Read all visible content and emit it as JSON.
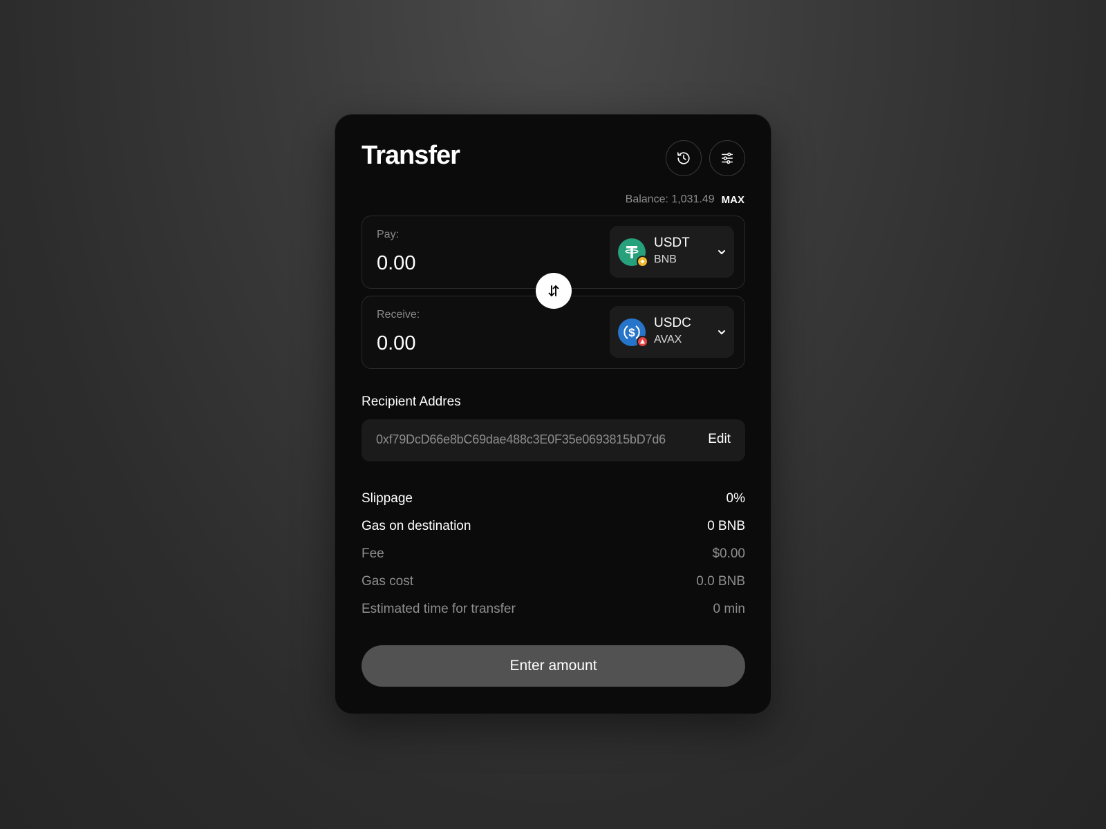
{
  "header": {
    "title": "Transfer",
    "history_icon": "history-clock-icon",
    "settings_icon": "sliders-settings-icon"
  },
  "balance": {
    "text": "Balance: 1,031.49",
    "max_label": "MAX"
  },
  "pay": {
    "label": "Pay:",
    "amount": "0.00",
    "token": {
      "symbol": "USDT",
      "chain": "BNB",
      "logo_color": "#26a17b",
      "badge_color": "#f3ba2f"
    }
  },
  "receive": {
    "label": "Receive:",
    "amount": "0.00",
    "token": {
      "symbol": "USDC",
      "chain": "AVAX",
      "logo_color": "#2775ca",
      "badge_color": "#e84142"
    }
  },
  "swap_icon": "swap-arrows-icon",
  "recipient": {
    "label": "Recipient Addres",
    "address": "0xf79DcD66e8bC69dae488c3E0F35e0693815bD7d6",
    "edit_label": "Edit"
  },
  "details": [
    {
      "label": "Slippage",
      "value": "0%",
      "style": "primary"
    },
    {
      "label": "Gas on destination",
      "value": "0 BNB",
      "style": "primary"
    },
    {
      "label": "Fee",
      "value": "$0.00",
      "style": "secondary"
    },
    {
      "label": "Gas cost",
      "value": "0.0 BNB",
      "style": "secondary"
    },
    {
      "label": "Estimated time for transfer",
      "value": "0 min",
      "style": "secondary"
    }
  ],
  "cta": {
    "label": "Enter amount"
  },
  "colors": {
    "card_bg": "#0b0b0b",
    "cta_bg": "#525252",
    "muted_text": "#8e8e8e"
  }
}
